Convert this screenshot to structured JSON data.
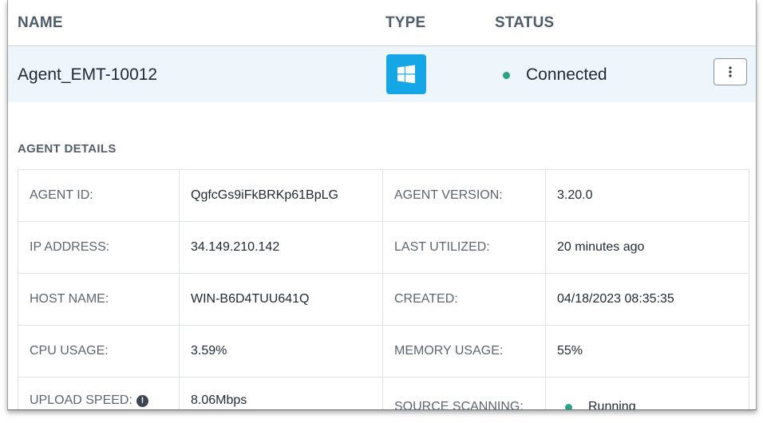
{
  "header": {
    "name_label": "NAME",
    "type_label": "TYPE",
    "status_label": "STATUS"
  },
  "agent": {
    "name": "Agent_EMT-10012",
    "type_icon": "windows-icon",
    "status": "Connected",
    "status_color": "#2aa382",
    "menu_icon": "kebab-menu-icon"
  },
  "details": {
    "title": "AGENT DETAILS",
    "rows": [
      {
        "l1": "AGENT ID:",
        "v1": "QgfcGs9iFkBRKp61BpLG",
        "l2": "AGENT VERSION:",
        "v2": "3.20.0"
      },
      {
        "l1": "IP ADDRESS:",
        "v1": "34.149.210.142",
        "l2": "LAST UTILIZED:",
        "v2": "20 minutes ago"
      },
      {
        "l1": "HOST NAME:",
        "v1": "WIN-B6D4TUU641Q",
        "l2": "CREATED:",
        "v2": "04/18/2023 08:35:35"
      },
      {
        "l1": "CPU USAGE:",
        "v1": "3.59%",
        "l2": "MEMORY USAGE:",
        "v2": "55%"
      },
      {
        "l1": "UPLOAD SPEED:",
        "v1": "8.06Mbps",
        "l2": "SOURCE SCANNING:",
        "v2": "Running"
      }
    ],
    "upload_info_icon": "info-icon"
  },
  "colors": {
    "accent": "#15a6e8",
    "row_highlight": "#eef5fb",
    "status_green": "#2aa382"
  }
}
